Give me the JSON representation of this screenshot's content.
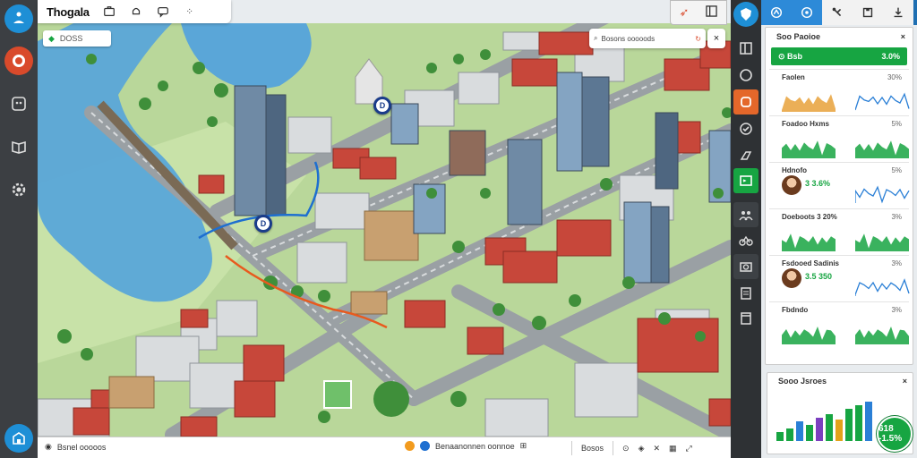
{
  "app": {
    "title": "Thogala"
  },
  "left_rail": {
    "items": [
      {
        "icon": "meditation-icon",
        "color": "#1e8fd6"
      },
      {
        "icon": "target-icon",
        "color": "#d94a2b"
      },
      {
        "icon": "ai-face-icon",
        "color": "#3c3f43"
      },
      {
        "icon": "book-icon",
        "color": "#3c3f43"
      },
      {
        "icon": "gear-icon",
        "color": "#3c3f43"
      },
      {
        "icon": "building-icon",
        "color": "#1e8fd6"
      }
    ]
  },
  "map": {
    "filter": {
      "value": "DOSS"
    },
    "search": {
      "placeholder": "Bosons ooooods"
    },
    "close_label": "×",
    "pins": [
      "D",
      "D"
    ]
  },
  "bottom_bar": {
    "left_text": "Bsnel ooooos",
    "mid_text": "Benaanonnen oonnoe",
    "right_text": "Bosos"
  },
  "right_panel": {
    "title": "Soo Paoioe",
    "close_label": "×",
    "banner": {
      "label": "Bsb",
      "value": "3.0%"
    },
    "metrics": [
      {
        "label": "Faolen",
        "pct": "30%",
        "value": "",
        "has_avatar": false
      },
      {
        "label": "Foadoo Hxms",
        "pct": "5%",
        "value": "",
        "has_avatar": false
      },
      {
        "label": "Hdnofo",
        "pct": "5%",
        "value": "3 3.6%",
        "has_avatar": true
      },
      {
        "label": "Doeboots 3 20%",
        "pct": "3%",
        "value": "",
        "has_avatar": false
      },
      {
        "label": "Fsdooed Sadinis",
        "pct": "3%",
        "value": "3.5 350",
        "has_avatar": true
      },
      {
        "label": "Fbdndo",
        "pct": "3%",
        "value": "",
        "has_avatar": false
      }
    ]
  },
  "summary_panel": {
    "title": "Sooo Jsroes",
    "close_label": "×",
    "badge": "618 -1.5%",
    "bar_colors": [
      "#17a542",
      "#17a542",
      "#2a7fd6",
      "#17a542",
      "#7b3fbf",
      "#17a542",
      "#e3a21a",
      "#17a542",
      "#17a542",
      "#2a7fd6"
    ]
  },
  "colors": {
    "accent": "#1f6fb2",
    "positive": "#17a542",
    "rail": "#3c3f43",
    "water": "#5aa6d8",
    "roof": "#c7473a"
  }
}
